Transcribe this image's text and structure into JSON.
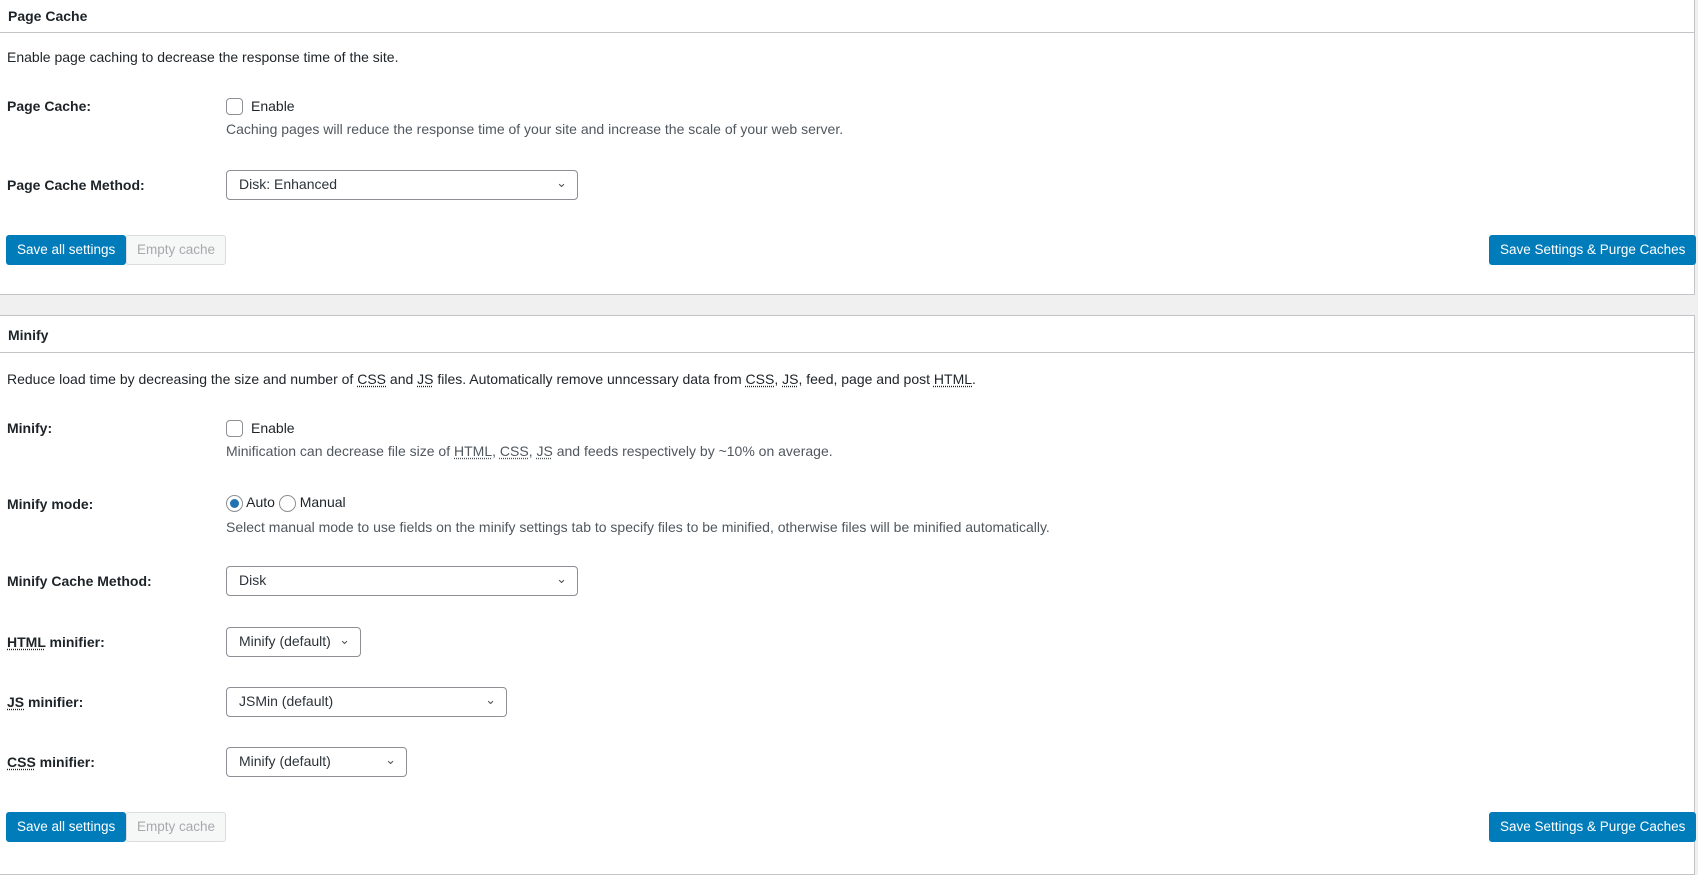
{
  "page_cache": {
    "title": "Page Cache",
    "description": "Enable page caching to decrease the response time of the site.",
    "enable_label": "Page Cache:",
    "enable_checkbox": "Enable",
    "enable_checked": false,
    "enable_hint": "Caching pages will reduce the response time of your site and increase the scale of your web server.",
    "method_label": "Page Cache Method:",
    "method_value": "Disk: Enhanced",
    "save_button": "Save all settings",
    "empty_button": "Empty cache",
    "purge_button": "Save Settings & Purge Caches"
  },
  "minify": {
    "title": "Minify",
    "description_parts": [
      "Reduce load time by decreasing the size and number of ",
      "CSS",
      " and ",
      "JS",
      " files. Automatically remove unncessary data from ",
      "CSS",
      ", ",
      "JS",
      ", feed, page and post ",
      "HTML",
      "."
    ],
    "enable_label": "Minify:",
    "enable_checkbox": "Enable",
    "enable_checked": false,
    "enable_hint_parts": [
      "Minification can decrease file size of ",
      "HTML",
      ", ",
      "CSS",
      ", ",
      "JS",
      " and feeds respectively by ~10% on average."
    ],
    "mode_label": "Minify mode:",
    "mode_auto": "Auto",
    "mode_manual": "Manual",
    "mode_selected": "Auto",
    "mode_hint": "Select manual mode to use fields on the minify settings tab to specify files to be minified, otherwise files will be minified automatically.",
    "cache_method_label": "Minify Cache Method:",
    "cache_method_value": "Disk",
    "html_abbr": "HTML",
    "html_label_rest": " minifier:",
    "html_value": "Minify (default)",
    "js_abbr": "JS",
    "js_label_rest": " minifier:",
    "js_value": "JSMin (default)",
    "css_abbr": "CSS",
    "css_label_rest": " minifier:",
    "css_value": "Minify (default)",
    "save_button": "Save all settings",
    "empty_button": "Empty cache",
    "purge_button": "Save Settings & Purge Caches"
  },
  "colors": {
    "primary": "#007cba",
    "background": "#f0f0f1"
  },
  "icons": {
    "select": "chevron-down-icon"
  }
}
